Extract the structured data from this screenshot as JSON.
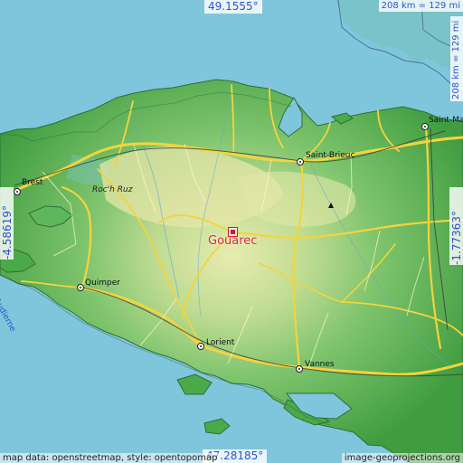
{
  "coordinates": {
    "top_latitude": "49.1555°",
    "bottom_latitude": "47.28185°",
    "left_longitude": "-4.58619°",
    "right_longitude": "-1.77363°"
  },
  "scale": {
    "top": "208 km = 129 mi",
    "right": "208 km = 129 mi"
  },
  "target": {
    "name": "Gouarec"
  },
  "places": {
    "brest": "Brest",
    "saint_brieuc": "Saint-Brieuc",
    "saint_malo": "Saint-Ma",
    "quimper": "Quimper",
    "lorient": "Lorient",
    "vannes": "Vannes",
    "roc_h_ruz": "Roc'h Ruz"
  },
  "water_labels": {
    "audierne": "d'Audierne"
  },
  "attribution": {
    "left": "map data: openstreetmap, style: opentopomap",
    "right": "image-geoprojections.org"
  },
  "colors": {
    "sea": "#7fc6dc",
    "lowland": "#4fb04f",
    "highland": "#e9e8a8",
    "roads": "#f3d43d",
    "coordinate_text": "#2d54c9",
    "target": "#c21f28"
  }
}
